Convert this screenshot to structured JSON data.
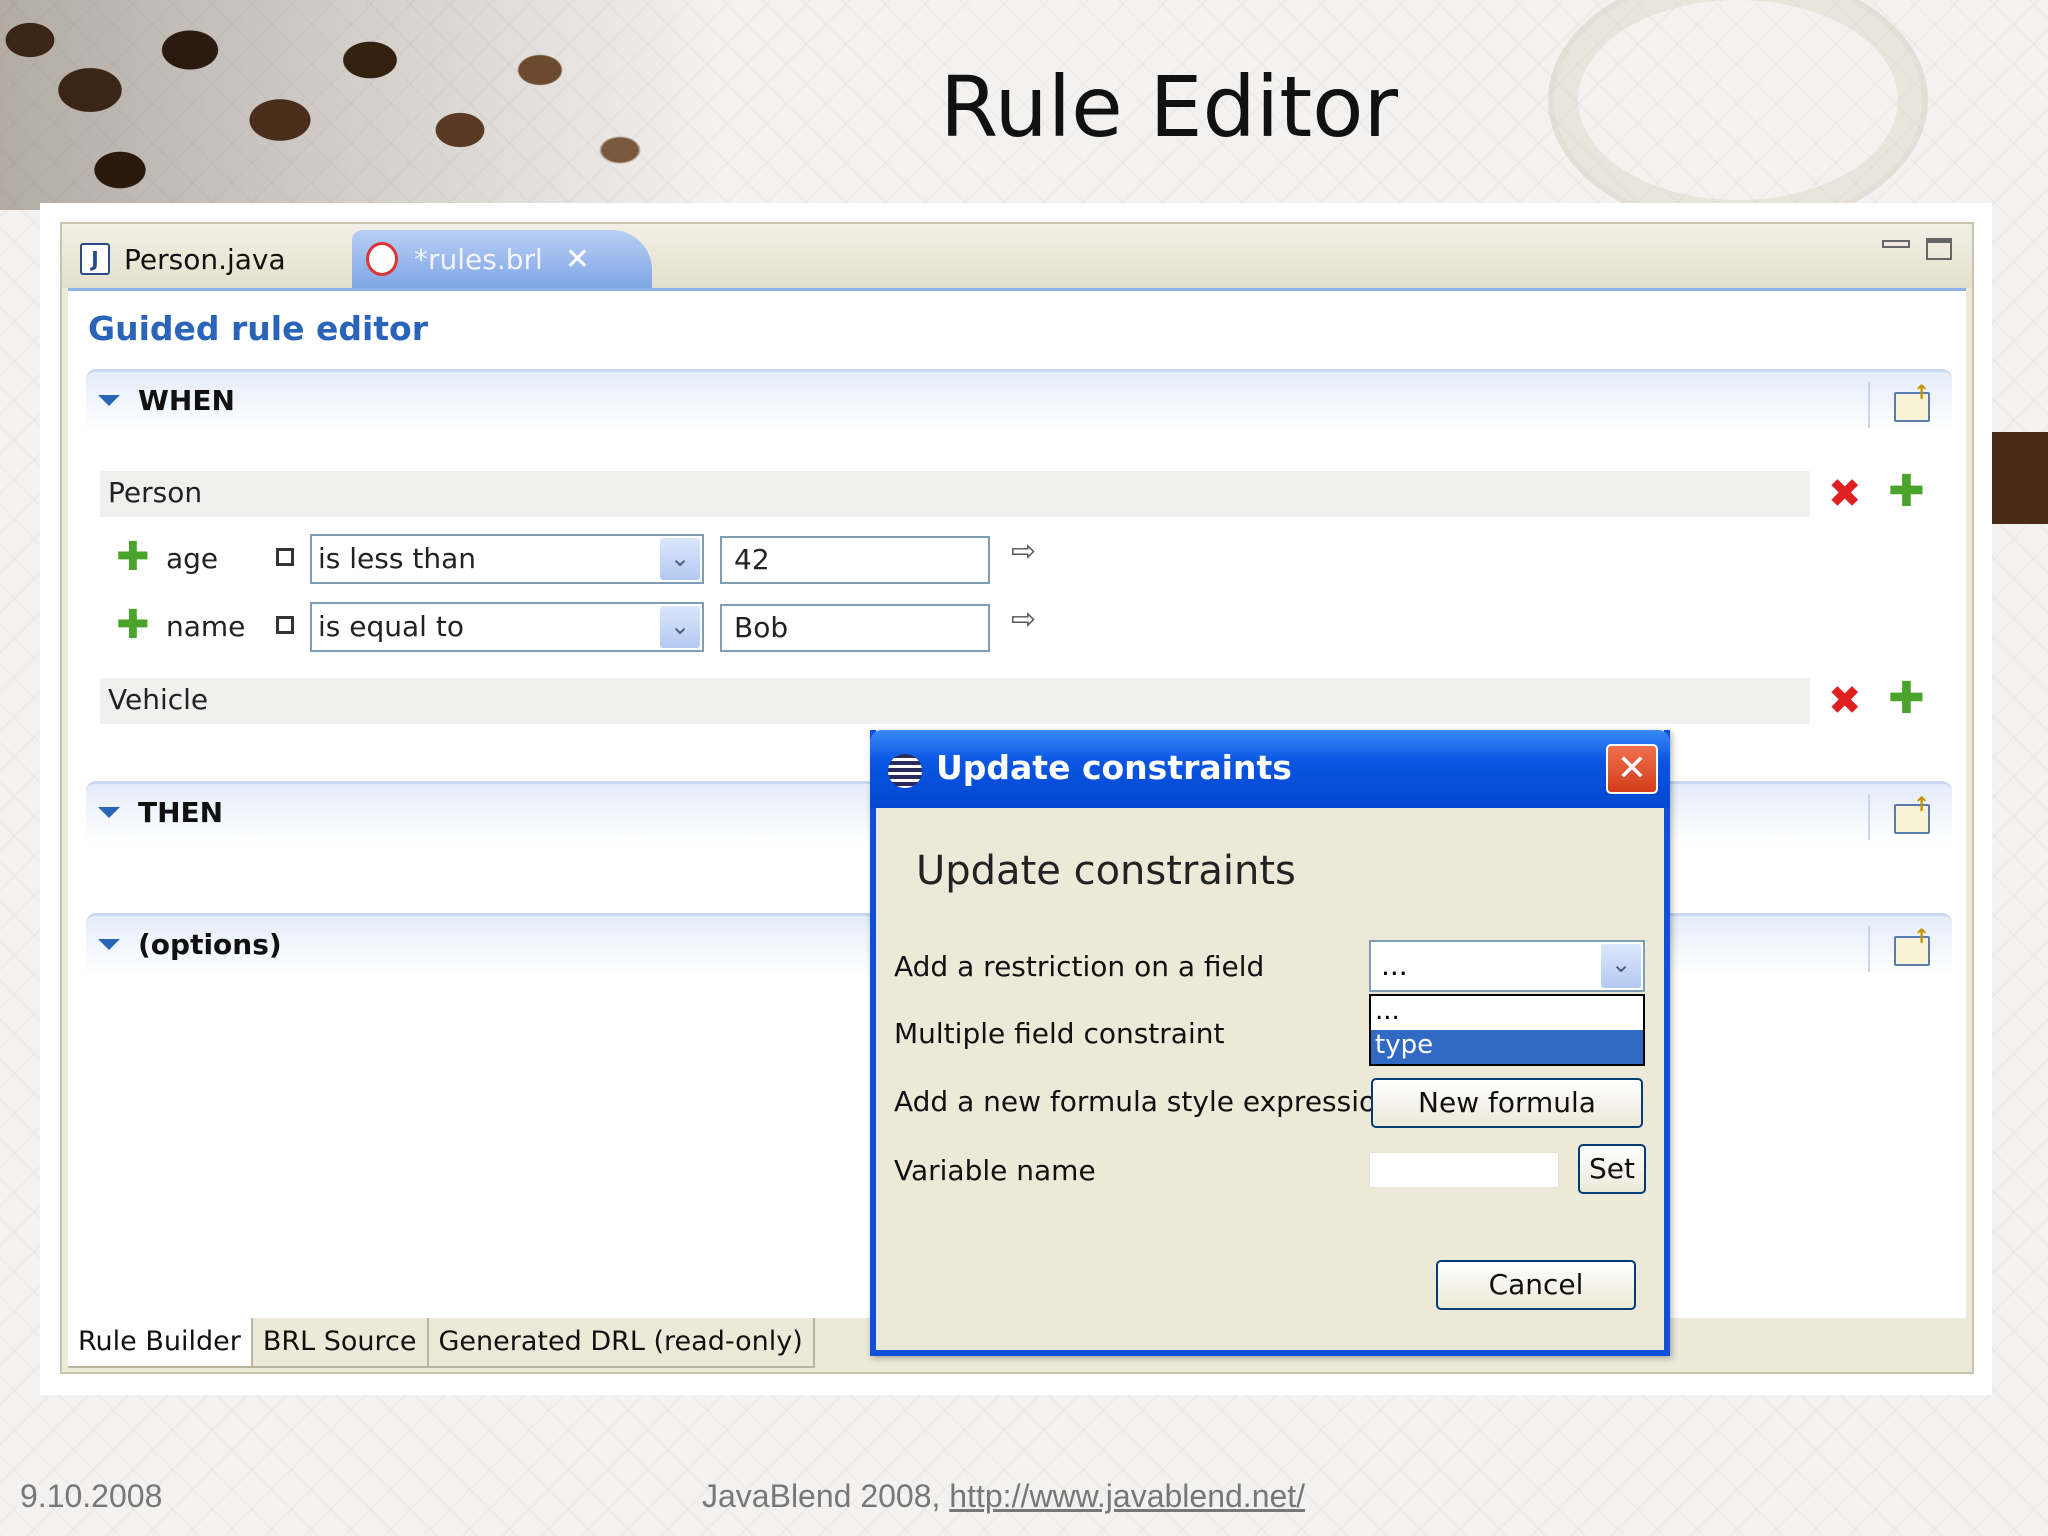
{
  "slide": {
    "title": "Rule Editor",
    "footer_date": "9.10.2008",
    "footer_text": "JavaBlend 2008, ",
    "footer_link": "http://www.javablend.net/"
  },
  "tabs": [
    {
      "label": "Person.java",
      "icon": "java-file-icon"
    },
    {
      "label": "*rules.brl",
      "icon": "drools-file-icon",
      "close": "✕"
    }
  ],
  "editor": {
    "title": "Guided rule editor",
    "sections": {
      "when": "WHEN",
      "then": "THEN",
      "options": "(options)"
    },
    "facts": [
      {
        "name": "Person",
        "fields": [
          {
            "label": "age",
            "operator": "is less than",
            "value": "42"
          },
          {
            "label": "name",
            "operator": "is equal to",
            "value": "Bob"
          }
        ]
      },
      {
        "name": "Vehicle",
        "fields": []
      }
    ],
    "bottom_tabs": [
      "Rule Builder",
      "BRL Source",
      "Generated DRL (read-only)"
    ]
  },
  "dialog": {
    "title": "Update constraints",
    "heading": "Update constraints",
    "close": "✕",
    "restriction_label": "Add a restriction on a field",
    "restriction_value": "...",
    "dropdown_options": [
      "...",
      "type"
    ],
    "dropdown_selected": "type",
    "multiple_label": "Multiple field constraint",
    "formula_label": "Add a new formula style expression",
    "formula_button": "New formula",
    "variable_label": "Variable name",
    "variable_value": "",
    "set_button": "Set",
    "cancel_button": "Cancel"
  },
  "colors": {
    "accent": "#2a64b8",
    "dialog_title_bar": "#0a55e2",
    "delete_icon": "#e02020",
    "add_icon": "#4aa32a",
    "selected_option": "#316ac5"
  }
}
